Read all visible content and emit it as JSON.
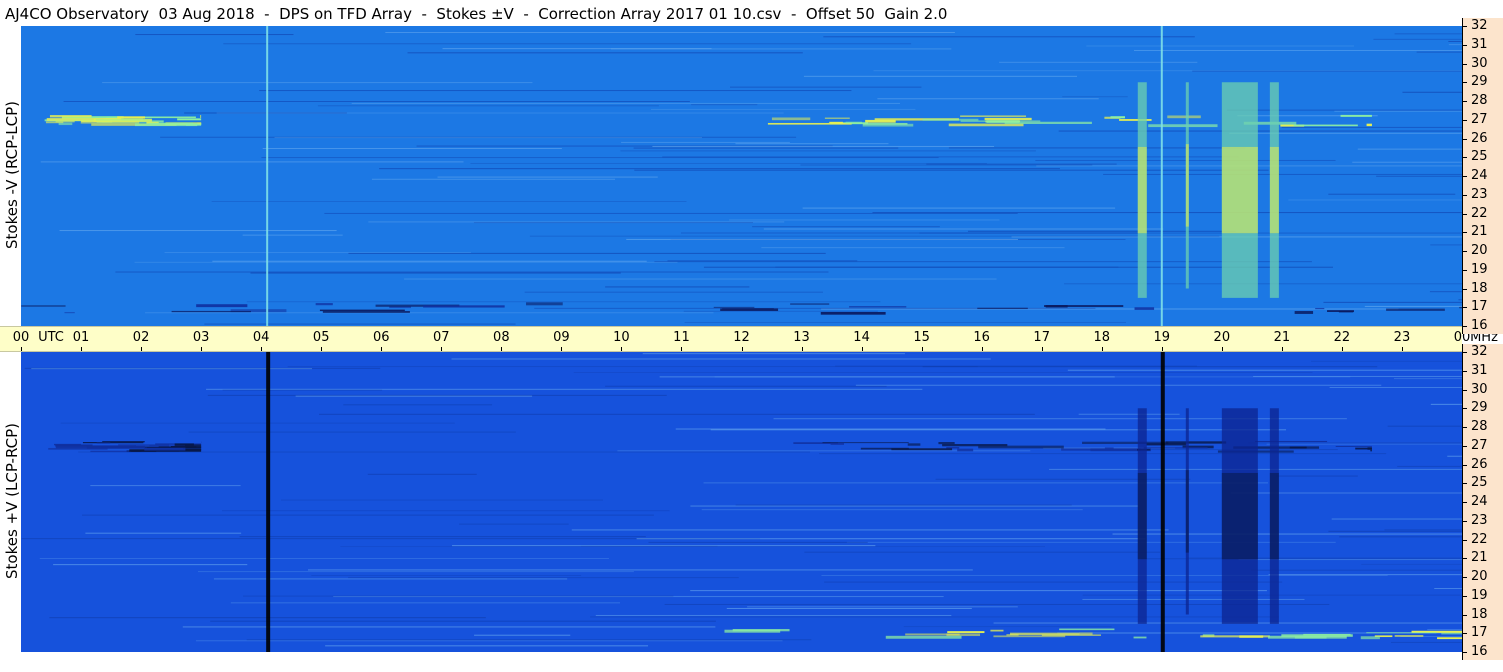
{
  "title": "AJ4CO Observatory  03 Aug 2018  -  DPS on TFD Array  -  Stokes ±V  -  Correction Array 2017 01 10.csv  -  Offset 50  Gain 2.0",
  "chart_data": [
    {
      "type": "heatmap",
      "title": "AJ4CO Observatory  03 Aug 2018  -  DPS on TFD Array  -  Stokes ±V  -  Correction Array 2017 01 10.csv  -  Offset 50  Gain 2.0",
      "ylabel": "Stokes -V (RCP-LCP)",
      "xlabel": "UTC",
      "yunit": "MHz",
      "x_ticks": [
        "00",
        "01",
        "02",
        "03",
        "04",
        "05",
        "06",
        "07",
        "08",
        "09",
        "10",
        "11",
        "12",
        "13",
        "14",
        "15",
        "16",
        "17",
        "18",
        "19",
        "20",
        "21",
        "22",
        "23",
        "00"
      ],
      "y_ticks": [
        "32",
        "31",
        "30",
        "29",
        "28",
        "27",
        "26",
        "25",
        "24",
        "23",
        "22",
        "21",
        "20",
        "19",
        "18",
        "17",
        "16"
      ],
      "xlim": [
        0,
        24
      ],
      "ylim": [
        16,
        32
      ],
      "colors": {
        "background": "#1c78e4",
        "bright": "#e8f050",
        "dark": "#0a1a60"
      },
      "features": [
        {
          "kind": "band",
          "utc": [
            0.0,
            3.0
          ],
          "mhz": 27.0,
          "level": "bright"
        },
        {
          "kind": "band",
          "utc": [
            11.8,
            22.5
          ],
          "mhz": 27.0,
          "level": "bright"
        },
        {
          "kind": "band",
          "utc": [
            0.0,
            24.0
          ],
          "mhz": 17.0,
          "level": "dark"
        },
        {
          "kind": "vline",
          "utc": 4.1,
          "level": "bright"
        },
        {
          "kind": "vline",
          "utc": 19.0,
          "level": "bright"
        },
        {
          "kind": "column",
          "utc": [
            18.6,
            18.75
          ],
          "mhz": [
            17.5,
            29.0
          ],
          "level": "bright"
        },
        {
          "kind": "column",
          "utc": [
            19.4,
            19.45
          ],
          "mhz": [
            18.0,
            29.0
          ],
          "level": "bright"
        },
        {
          "kind": "column",
          "utc": [
            20.0,
            20.6
          ],
          "mhz": [
            17.5,
            29.0
          ],
          "level": "bright"
        },
        {
          "kind": "column",
          "utc": [
            20.8,
            20.95
          ],
          "mhz": [
            17.5,
            29.0
          ],
          "level": "bright"
        }
      ]
    },
    {
      "type": "heatmap",
      "ylabel": "Stokes +V (LCP-RCP)",
      "xlabel": "UTC",
      "yunit": "MHz",
      "x_ticks": [
        "00",
        "01",
        "02",
        "03",
        "04",
        "05",
        "06",
        "07",
        "08",
        "09",
        "10",
        "11",
        "12",
        "13",
        "14",
        "15",
        "16",
        "17",
        "18",
        "19",
        "20",
        "21",
        "22",
        "23",
        "00"
      ],
      "y_ticks": [
        "32",
        "31",
        "30",
        "29",
        "28",
        "27",
        "26",
        "25",
        "24",
        "23",
        "22",
        "21",
        "20",
        "19",
        "18",
        "17",
        "16"
      ],
      "xlim": [
        0,
        24
      ],
      "ylim": [
        16,
        32
      ],
      "colors": {
        "background": "#1652dc",
        "bright": "#e8f050",
        "dark": "#081848"
      },
      "features": [
        {
          "kind": "band",
          "utc": [
            0.0,
            3.0
          ],
          "mhz": 27.0,
          "level": "dark"
        },
        {
          "kind": "band",
          "utc": [
            11.8,
            22.5
          ],
          "mhz": 27.0,
          "level": "dark"
        },
        {
          "kind": "band",
          "utc": [
            11.0,
            24.0
          ],
          "mhz": 17.0,
          "level": "bright"
        },
        {
          "kind": "vline",
          "utc": 4.1,
          "level": "dark"
        },
        {
          "kind": "vline",
          "utc": 19.0,
          "level": "dark"
        },
        {
          "kind": "column",
          "utc": [
            18.6,
            18.75
          ],
          "mhz": [
            17.5,
            29.0
          ],
          "level": "dark"
        },
        {
          "kind": "column",
          "utc": [
            19.4,
            19.45
          ],
          "mhz": [
            18.0,
            29.0
          ],
          "level": "dark"
        },
        {
          "kind": "column",
          "utc": [
            20.0,
            20.6
          ],
          "mhz": [
            17.5,
            29.0
          ],
          "level": "dark"
        },
        {
          "kind": "column",
          "utc": [
            20.8,
            20.95
          ],
          "mhz": [
            17.5,
            29.0
          ],
          "level": "dark"
        }
      ]
    }
  ],
  "axis_labels": {
    "top_panel": "Stokes -V (RCP-LCP)",
    "bottom_panel": "Stokes +V (LCP-RCP)",
    "time_unit": "UTC",
    "freq_unit": "MHz"
  }
}
